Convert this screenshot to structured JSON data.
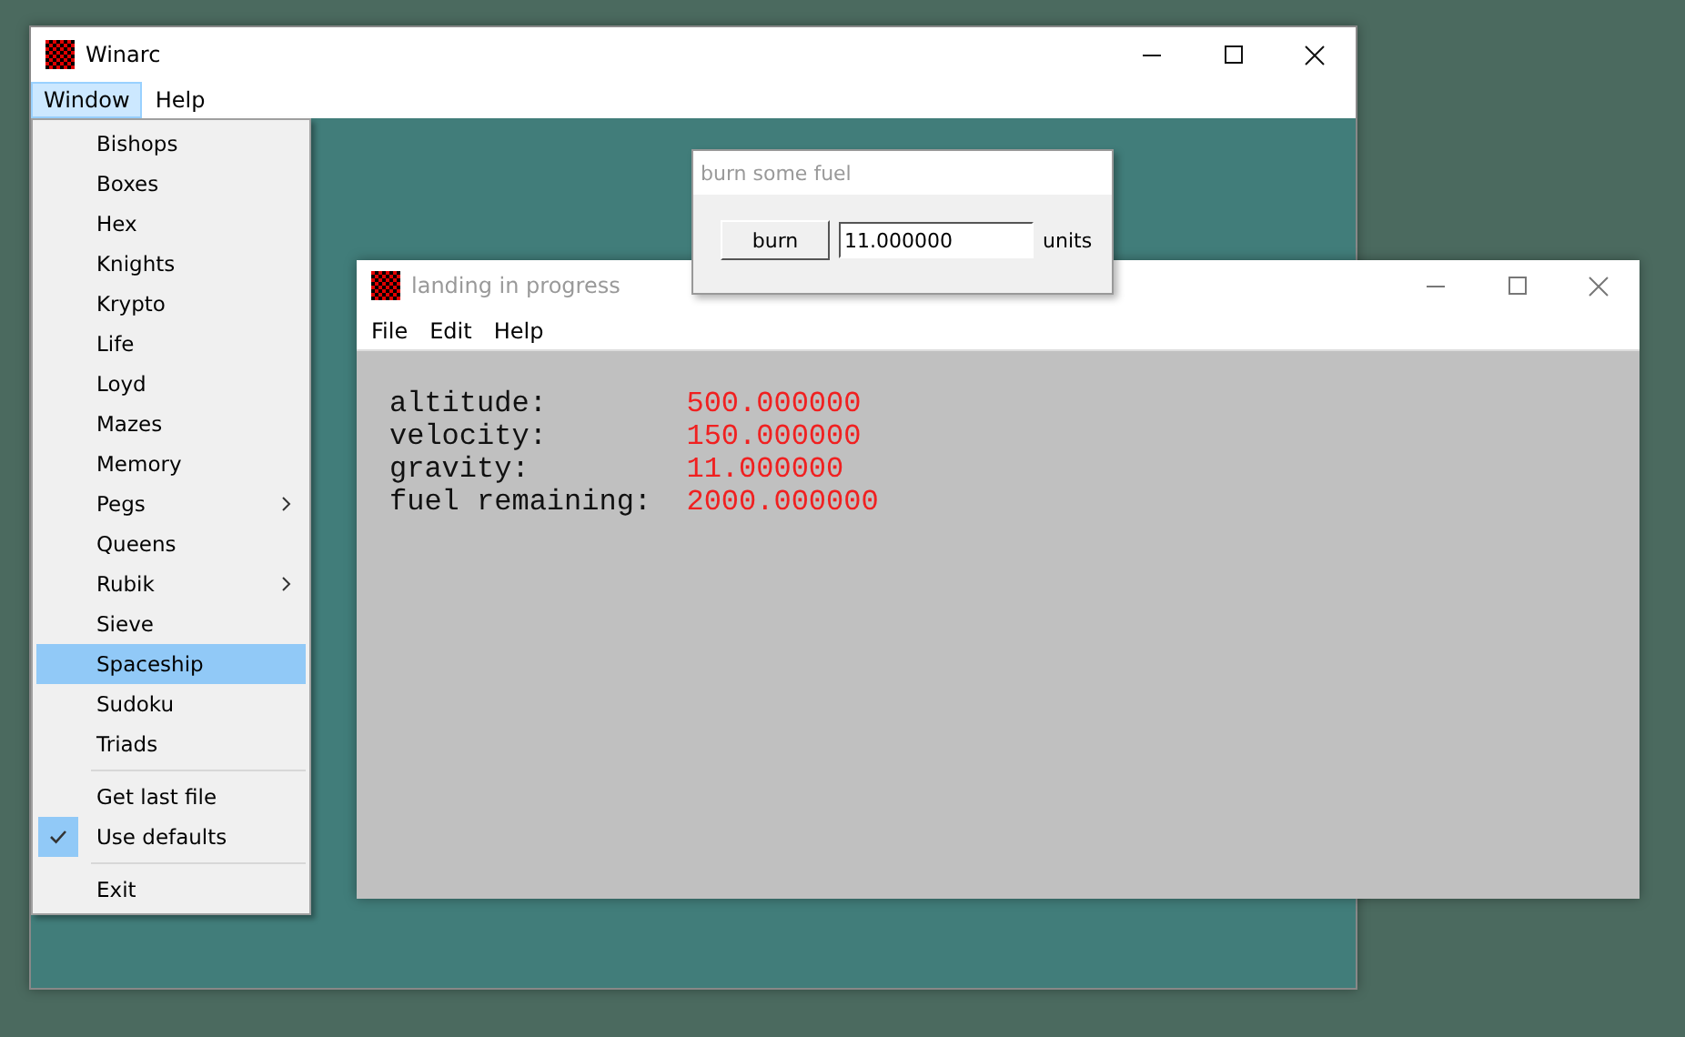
{
  "main_window": {
    "title": "Winarc",
    "menu": [
      {
        "label": "Window",
        "selected": true
      },
      {
        "label": "Help",
        "selected": false
      }
    ]
  },
  "window_menu": {
    "items": [
      {
        "kind": "item",
        "label": "Bishops",
        "selected": false,
        "checked": false,
        "submenu": false
      },
      {
        "kind": "item",
        "label": "Boxes",
        "selected": false,
        "checked": false,
        "submenu": false
      },
      {
        "kind": "item",
        "label": "Hex",
        "selected": false,
        "checked": false,
        "submenu": false
      },
      {
        "kind": "item",
        "label": "Knights",
        "selected": false,
        "checked": false,
        "submenu": false
      },
      {
        "kind": "item",
        "label": "Krypto",
        "selected": false,
        "checked": false,
        "submenu": false
      },
      {
        "kind": "item",
        "label": "Life",
        "selected": false,
        "checked": false,
        "submenu": false
      },
      {
        "kind": "item",
        "label": "Loyd",
        "selected": false,
        "checked": false,
        "submenu": false
      },
      {
        "kind": "item",
        "label": "Mazes",
        "selected": false,
        "checked": false,
        "submenu": false
      },
      {
        "kind": "item",
        "label": "Memory",
        "selected": false,
        "checked": false,
        "submenu": false
      },
      {
        "kind": "item",
        "label": "Pegs",
        "selected": false,
        "checked": false,
        "submenu": true
      },
      {
        "kind": "item",
        "label": "Queens",
        "selected": false,
        "checked": false,
        "submenu": false
      },
      {
        "kind": "item",
        "label": "Rubik",
        "selected": false,
        "checked": false,
        "submenu": true
      },
      {
        "kind": "item",
        "label": "Sieve",
        "selected": false,
        "checked": false,
        "submenu": false
      },
      {
        "kind": "item",
        "label": "Spaceship",
        "selected": true,
        "checked": false,
        "submenu": false
      },
      {
        "kind": "item",
        "label": "Sudoku",
        "selected": false,
        "checked": false,
        "submenu": false
      },
      {
        "kind": "item",
        "label": "Triads",
        "selected": false,
        "checked": false,
        "submenu": false
      },
      {
        "kind": "separator"
      },
      {
        "kind": "item",
        "label": "Get last file",
        "selected": false,
        "checked": false,
        "submenu": false
      },
      {
        "kind": "item",
        "label": "Use defaults",
        "selected": false,
        "checked": true,
        "submenu": false
      },
      {
        "kind": "separator"
      },
      {
        "kind": "item",
        "label": "Exit",
        "selected": false,
        "checked": false,
        "submenu": false
      }
    ]
  },
  "landing_window": {
    "title": "landing in progress",
    "menu": [
      "File",
      "Edit",
      "Help"
    ],
    "readouts": [
      {
        "label": "altitude:",
        "value": "500.000000"
      },
      {
        "label": "velocity:",
        "value": "150.000000"
      },
      {
        "label": "gravity:",
        "value": "11.000000"
      },
      {
        "label": "fuel remaining:",
        "value": "2000.000000"
      }
    ]
  },
  "burn_dialog": {
    "title": "burn some fuel",
    "button": "burn",
    "value": "11.000000",
    "unit": "units"
  }
}
